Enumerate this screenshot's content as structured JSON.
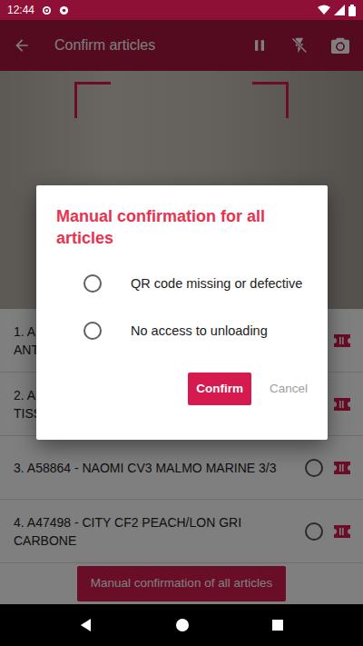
{
  "status_bar": {
    "time": "12:44"
  },
  "app_bar": {
    "title": "Confirm articles"
  },
  "articles": [
    {
      "lines": [
        "1. A",
        "ANT"
      ],
      "checked": false
    },
    {
      "lines": [
        "2. A",
        "TISS"
      ],
      "checked": false
    },
    {
      "lines": [
        "3. A58864 - NAOMI CV3 MALMO MARINE 3/3"
      ],
      "checked": false
    },
    {
      "lines": [
        "4. A47498 - CITY CF2 PEACH/LON GRI CARBONE"
      ],
      "checked": false
    }
  ],
  "bottom_button": "Manual confirmation of all articles",
  "dialog": {
    "title": "Manual confirmation for all articles",
    "options": [
      {
        "label": "QR code missing or defective",
        "selected": false
      },
      {
        "label": "No access to unloading",
        "selected": false
      }
    ],
    "confirm": "Confirm",
    "cancel": "Cancel"
  }
}
